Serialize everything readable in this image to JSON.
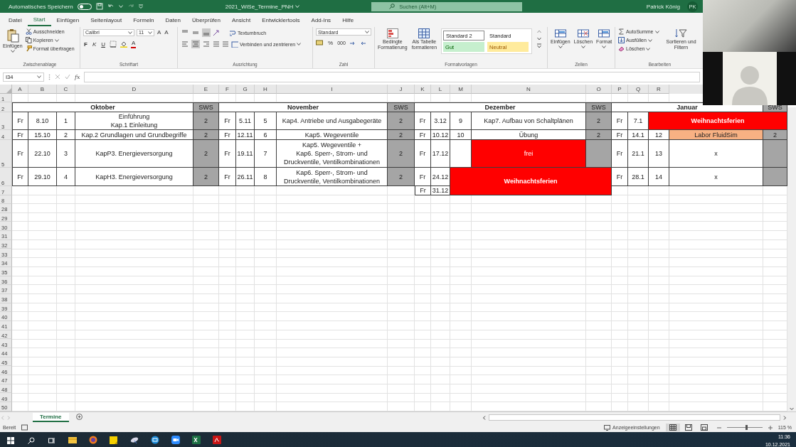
{
  "title_bar": {
    "autosave_label": "Automatisches Speichern",
    "autosave_on": false,
    "filename": "2021_WiSe_Termine_PNH",
    "search_placeholder": "Suchen (Alt+M)",
    "user_name": "Patrick König",
    "user_initials": "PK"
  },
  "menu_tabs": [
    {
      "label": "Datei",
      "selected": false
    },
    {
      "label": "Start",
      "selected": true
    },
    {
      "label": "Einfügen",
      "selected": false
    },
    {
      "label": "Seitenlayout",
      "selected": false
    },
    {
      "label": "Formeln",
      "selected": false
    },
    {
      "label": "Daten",
      "selected": false
    },
    {
      "label": "Überprüfen",
      "selected": false
    },
    {
      "label": "Ansicht",
      "selected": false
    },
    {
      "label": "Entwicklertools",
      "selected": false
    },
    {
      "label": "Add-Ins",
      "selected": false
    },
    {
      "label": "Hilfe",
      "selected": false
    }
  ],
  "ribbon": {
    "clipboard": {
      "label": "Zwischenablage",
      "paste": "Einfügen",
      "cut": "Ausschneiden",
      "copy": "Kopieren",
      "format_painter": "Format übertragen"
    },
    "font": {
      "label": "Schriftart",
      "family": "Calibri",
      "size": "11",
      "grow": "A",
      "shrink": "A",
      "bold": "F",
      "italic": "K",
      "underline": "U",
      "font_color": "A"
    },
    "alignment": {
      "label": "Ausrichtung",
      "vertical": [
        {
          "selected": false
        },
        {
          "selected": false
        },
        {
          "selected": true
        }
      ],
      "horizontal": [
        {
          "selected": false
        },
        {
          "selected": true
        },
        {
          "selected": false
        }
      ],
      "wrap": "Textumbruch",
      "merge": "Verbinden und zentrieren"
    },
    "number": {
      "label": "Zahl",
      "format": "Standard",
      "percent": "%",
      "thousands": "000"
    },
    "styles": {
      "label": "Formatvorlagen",
      "conditional": "Bedingte\nFormatierung",
      "as_table": "Als Tabelle\nformatieren",
      "cell_styles": [
        {
          "label": "Standard 2",
          "kind": "boxed"
        },
        {
          "label": "Standard",
          "kind": "normal"
        },
        {
          "label": "Gut",
          "kind": "good"
        },
        {
          "label": "Neutral",
          "kind": "neutral"
        }
      ]
    },
    "cells": {
      "label": "Zellen",
      "insert": "Einfügen",
      "delete": "Löschen",
      "format": "Format"
    },
    "editing": {
      "label": "Bearbeiten",
      "autosum": "AutoSumme",
      "fill": "Ausfüllen",
      "clear": "Löschen",
      "sort": "Sortieren und\nFiltern"
    }
  },
  "formula_bar": {
    "name_box": "I34",
    "fx": "fx"
  },
  "sheet": {
    "columns": [
      "A",
      "B",
      "C",
      "D",
      "E",
      "F",
      "G",
      "H",
      "I",
      "J",
      "K",
      "L",
      "M",
      "N",
      "O",
      "P",
      "Q",
      "R"
    ],
    "rows": [
      {
        "label": "1",
        "cells": []
      },
      {
        "label": "2",
        "cells": [
          {
            "text": "Oktober",
            "kind": "month",
            "colspan": 4
          },
          {
            "text": "SWS",
            "kind": "sws"
          },
          {
            "text": "November",
            "kind": "month",
            "colspan": 4
          },
          {
            "text": "SWS",
            "kind": "sws"
          },
          {
            "text": "Dezember",
            "kind": "month",
            "colspan": 4
          },
          {
            "text": "SWS",
            "kind": "sws"
          },
          {
            "text": "Januar",
            "kind": "month",
            "colspan": 4
          },
          {
            "text": "SWS",
            "kind": "sws"
          }
        ]
      },
      {
        "label": "3",
        "cells": [
          {
            "text": "Fr",
            "kind": "plain"
          },
          {
            "text": "8.10",
            "kind": "plain"
          },
          {
            "text": "1",
            "kind": "plain"
          },
          {
            "text": "Einführung\nKap.1 Einleitung",
            "kind": "plain"
          },
          {
            "text": "2",
            "kind": "sws"
          },
          {
            "text": "Fr",
            "kind": "plain"
          },
          {
            "text": "5.11",
            "kind": "plain"
          },
          {
            "text": "5",
            "kind": "plain"
          },
          {
            "text": "Kap4. Antriebe und Ausgabegeräte",
            "kind": "plain"
          },
          {
            "text": "2",
            "kind": "sws"
          },
          {
            "text": "Fr",
            "kind": "plain"
          },
          {
            "text": "3.12",
            "kind": "plain"
          },
          {
            "text": "9",
            "kind": "plain"
          },
          {
            "text": "Kap7. Aufbau von Schaltplänen",
            "kind": "plain"
          },
          {
            "text": "2",
            "kind": "sws"
          },
          {
            "text": "Fr",
            "kind": "plain"
          },
          {
            "text": "7.1",
            "kind": "plain"
          },
          {
            "text": "Weihnachtsferien",
            "kind": "holiday",
            "colspan": 3
          }
        ]
      },
      {
        "label": "4",
        "cells": [
          {
            "text": "Fr",
            "kind": "plain"
          },
          {
            "text": "15.10",
            "kind": "plain"
          },
          {
            "text": "2",
            "kind": "plain"
          },
          {
            "text": "Kap.2 Grundlagen und Grundbegriffe",
            "kind": "plain"
          },
          {
            "text": "2",
            "kind": "sws"
          },
          {
            "text": "Fr",
            "kind": "plain"
          },
          {
            "text": "12.11",
            "kind": "plain"
          },
          {
            "text": "6",
            "kind": "plain"
          },
          {
            "text": "Kap5. Wegeventile",
            "kind": "plain"
          },
          {
            "text": "2",
            "kind": "sws"
          },
          {
            "text": "Fr",
            "kind": "plain"
          },
          {
            "text": "10.12",
            "kind": "plain"
          },
          {
            "text": "10",
            "kind": "plain"
          },
          {
            "text": "Übung",
            "kind": "plain"
          },
          {
            "text": "2",
            "kind": "sws"
          },
          {
            "text": "Fr",
            "kind": "plain"
          },
          {
            "text": "14.1",
            "kind": "plain"
          },
          {
            "text": "12",
            "kind": "plain"
          },
          {
            "text": "Labor FluidSim",
            "kind": "lab"
          },
          {
            "text": "2",
            "kind": "sws"
          }
        ]
      },
      {
        "label": "5",
        "cells": [
          {
            "text": "Fr",
            "kind": "plain"
          },
          {
            "text": "22.10",
            "kind": "plain"
          },
          {
            "text": "3",
            "kind": "plain"
          },
          {
            "text": "KapP3. Energieversorgung",
            "kind": "plain"
          },
          {
            "text": "2",
            "kind": "sws"
          },
          {
            "text": "Fr",
            "kind": "plain"
          },
          {
            "text": "19.11",
            "kind": "plain"
          },
          {
            "text": "7",
            "kind": "plain"
          },
          {
            "text": "Kap5. Wegeventile +\nKap6. Sperr-, Strom- und\nDruckventile, Ventilkombinationen",
            "kind": "plain"
          },
          {
            "text": "2",
            "kind": "sws"
          },
          {
            "text": "Fr",
            "kind": "plain"
          },
          {
            "text": "17.12",
            "kind": "plain"
          },
          {
            "kind": "plain"
          },
          {
            "text": "frei",
            "kind": "free"
          },
          {
            "kind": "sws"
          },
          {
            "text": "Fr",
            "kind": "plain"
          },
          {
            "text": "21.1",
            "kind": "plain"
          },
          {
            "text": "13",
            "kind": "plain"
          },
          {
            "text": "x",
            "kind": "plain"
          },
          {
            "kind": "sws"
          }
        ]
      },
      {
        "label": "6",
        "cells": [
          {
            "text": "Fr",
            "kind": "plain"
          },
          {
            "text": "29.10",
            "kind": "plain"
          },
          {
            "text": "4",
            "kind": "plain"
          },
          {
            "text": "KapH3. Energieversorgung",
            "kind": "plain"
          },
          {
            "text": "2",
            "kind": "sws"
          },
          {
            "text": "Fr",
            "kind": "plain"
          },
          {
            "text": "26.11",
            "kind": "plain"
          },
          {
            "text": "8",
            "kind": "plain"
          },
          {
            "text": "Kap6. Sperr-, Strom- und\nDruckventile, Ventilkombinationen",
            "kind": "plain"
          },
          {
            "text": "2",
            "kind": "sws"
          },
          {
            "text": "Fr",
            "kind": "plain"
          },
          {
            "text": "24.12",
            "kind": "plain"
          },
          {
            "text": "Weihnachtsferien",
            "kind": "holiday",
            "colspan": 3,
            "rowspan": 2
          },
          {
            "text": "Fr",
            "kind": "plain"
          },
          {
            "text": "28.1",
            "kind": "plain"
          },
          {
            "text": "14",
            "kind": "plain"
          },
          {
            "text": "x",
            "kind": "plain"
          },
          {
            "kind": "sws"
          }
        ]
      },
      {
        "label": "7",
        "cells": [
          "",
          "",
          "",
          "",
          "",
          "",
          "",
          "",
          "",
          "",
          {
            "text": "Fr",
            "kind": "plain"
          },
          {
            "text": "31.12",
            "kind": "plain"
          }
        ]
      },
      {
        "label": "8",
        "cells": []
      },
      {
        "label": "28",
        "cells": []
      },
      {
        "label": "29",
        "cells": []
      },
      {
        "label": "30",
        "cells": []
      },
      {
        "label": "31",
        "cells": []
      },
      {
        "label": "32",
        "cells": []
      },
      {
        "label": "33",
        "cells": []
      },
      {
        "label": "34",
        "cells": []
      },
      {
        "label": "35",
        "cells": []
      },
      {
        "label": "36",
        "cells": []
      },
      {
        "label": "37",
        "cells": []
      },
      {
        "label": "38",
        "cells": []
      },
      {
        "label": "39",
        "cells": []
      },
      {
        "label": "40",
        "cells": []
      },
      {
        "label": "41",
        "cells": []
      },
      {
        "label": "42",
        "cells": []
      },
      {
        "label": "43",
        "cells": []
      },
      {
        "label": "44",
        "cells": []
      },
      {
        "label": "45",
        "cells": []
      },
      {
        "label": "46",
        "cells": []
      },
      {
        "label": "47",
        "cells": []
      },
      {
        "label": "48",
        "cells": []
      },
      {
        "label": "49",
        "cells": []
      },
      {
        "label": "50",
        "cells": []
      }
    ]
  },
  "sheet_tabs": [
    {
      "label": "Termine",
      "selected": true
    }
  ],
  "status_bar": {
    "ready": "Bereit",
    "display_settings": "Anzeigeeinstellungen",
    "views": [
      {
        "selected": true
      },
      {
        "selected": false
      },
      {
        "selected": false
      }
    ],
    "zoom_slider": {
      "level": 0.55
    },
    "zoom": "115 %"
  },
  "taskbar": {
    "time": "11:36",
    "date": "10.12.2021"
  }
}
